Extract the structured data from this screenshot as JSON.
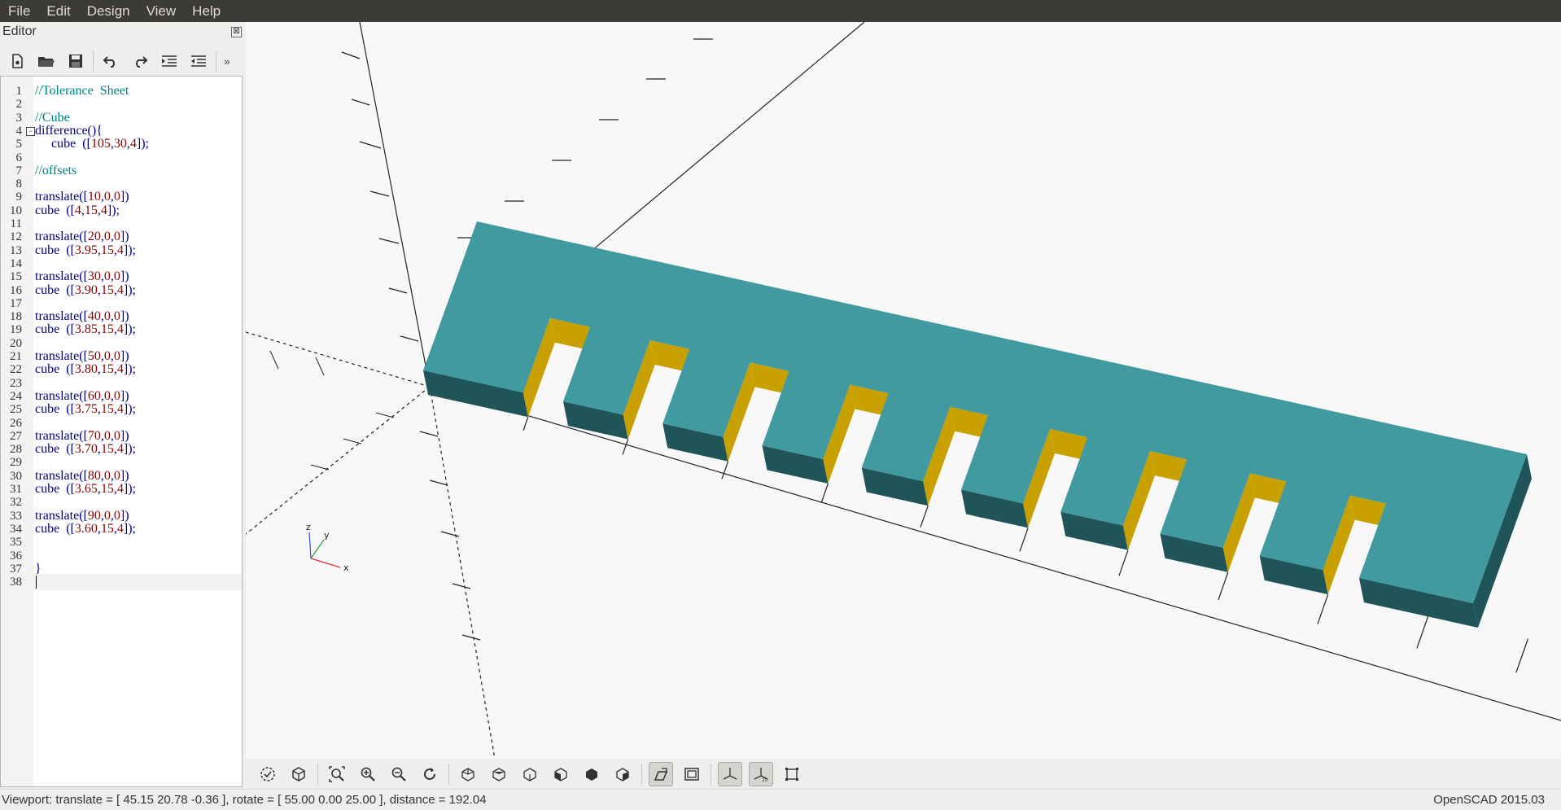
{
  "menu": [
    "File",
    "Edit",
    "Design",
    "View",
    "Help"
  ],
  "editor": {
    "title": "Editor",
    "close_glyph": "⊠",
    "toolbar_icons": [
      "new-file-icon",
      "open-file-icon",
      "save-icon",
      "undo-icon",
      "redo-icon",
      "indent-icon",
      "unindent-icon",
      "more-icon"
    ],
    "lines": [
      {
        "n": "1",
        "text": "//Tolerance  Sheet",
        "kind": "comment"
      },
      {
        "n": "2",
        "text": "",
        "kind": "plain"
      },
      {
        "n": "3",
        "text": "//Cube",
        "kind": "comment"
      },
      {
        "n": "4",
        "text": "difference(){",
        "kind": "kw"
      },
      {
        "n": "5",
        "text": "     cube  ([105,30,4]);",
        "kind": "code"
      },
      {
        "n": "6",
        "text": "",
        "kind": "plain"
      },
      {
        "n": "7",
        "text": "//offsets",
        "kind": "comment"
      },
      {
        "n": "8",
        "text": "",
        "kind": "plain"
      },
      {
        "n": "9",
        "text": "translate([10,0,0])",
        "kind": "code"
      },
      {
        "n": "10",
        "text": "cube  ([4,15,4]);",
        "kind": "code"
      },
      {
        "n": "11",
        "text": "",
        "kind": "plain"
      },
      {
        "n": "12",
        "text": "translate([20,0,0])",
        "kind": "code"
      },
      {
        "n": "13",
        "text": "cube  ([3.95,15,4]);",
        "kind": "code"
      },
      {
        "n": "14",
        "text": "",
        "kind": "plain"
      },
      {
        "n": "15",
        "text": "translate([30,0,0])",
        "kind": "code"
      },
      {
        "n": "16",
        "text": "cube  ([3.90,15,4]);",
        "kind": "code"
      },
      {
        "n": "17",
        "text": "",
        "kind": "plain"
      },
      {
        "n": "18",
        "text": "translate([40,0,0])",
        "kind": "code"
      },
      {
        "n": "19",
        "text": "cube  ([3.85,15,4]);",
        "kind": "code"
      },
      {
        "n": "20",
        "text": "",
        "kind": "plain"
      },
      {
        "n": "21",
        "text": "translate([50,0,0])",
        "kind": "code"
      },
      {
        "n": "22",
        "text": "cube  ([3.80,15,4]);",
        "kind": "code"
      },
      {
        "n": "23",
        "text": "",
        "kind": "plain"
      },
      {
        "n": "24",
        "text": "translate([60,0,0])",
        "kind": "code"
      },
      {
        "n": "25",
        "text": "cube  ([3.75,15,4]);",
        "kind": "code"
      },
      {
        "n": "26",
        "text": "",
        "kind": "plain"
      },
      {
        "n": "27",
        "text": "translate([70,0,0])",
        "kind": "code"
      },
      {
        "n": "28",
        "text": "cube  ([3.70,15,4]);",
        "kind": "code"
      },
      {
        "n": "29",
        "text": "",
        "kind": "plain"
      },
      {
        "n": "30",
        "text": "translate([80,0,0])",
        "kind": "code"
      },
      {
        "n": "31",
        "text": "cube  ([3.65,15,4]);",
        "kind": "code"
      },
      {
        "n": "32",
        "text": "",
        "kind": "plain"
      },
      {
        "n": "33",
        "text": "translate([90,0,0])",
        "kind": "code"
      },
      {
        "n": "34",
        "text": "cube  ([3.60,15,4]);",
        "kind": "code"
      },
      {
        "n": "35",
        "text": "",
        "kind": "plain"
      },
      {
        "n": "36",
        "text": "",
        "kind": "plain"
      },
      {
        "n": "37",
        "text": "}",
        "kind": "kw"
      },
      {
        "n": "38",
        "text": "",
        "kind": "plain"
      }
    ]
  },
  "colors": {
    "comment": "#008080",
    "keyword": "#000080",
    "number": "#8b0000",
    "top_face": "#419a9f",
    "front_face": "#1f5459",
    "slot_wall": "#c8a000"
  },
  "axis_labels": {
    "x": "x",
    "y": "y",
    "z": "z"
  },
  "viewport_toolbar_icons": [
    "render-preview-icon",
    "render-icon",
    "view-all-icon",
    "zoom-in-icon",
    "zoom-out-icon",
    "reset-view-icon",
    "view-right-icon",
    "view-top-icon",
    "view-bottom-icon",
    "view-left-icon",
    "view-front-icon",
    "view-back-icon",
    "perspective-icon",
    "orthogonal-icon",
    "show-axes-icon",
    "show-scale-icon",
    "show-edges-icon"
  ],
  "status": {
    "viewport": "Viewport: translate = [ 45.15 20.78 -0.36 ], rotate = [ 55.00 0.00 25.00 ], distance = 192.04",
    "version": "OpenSCAD 2015.03"
  }
}
